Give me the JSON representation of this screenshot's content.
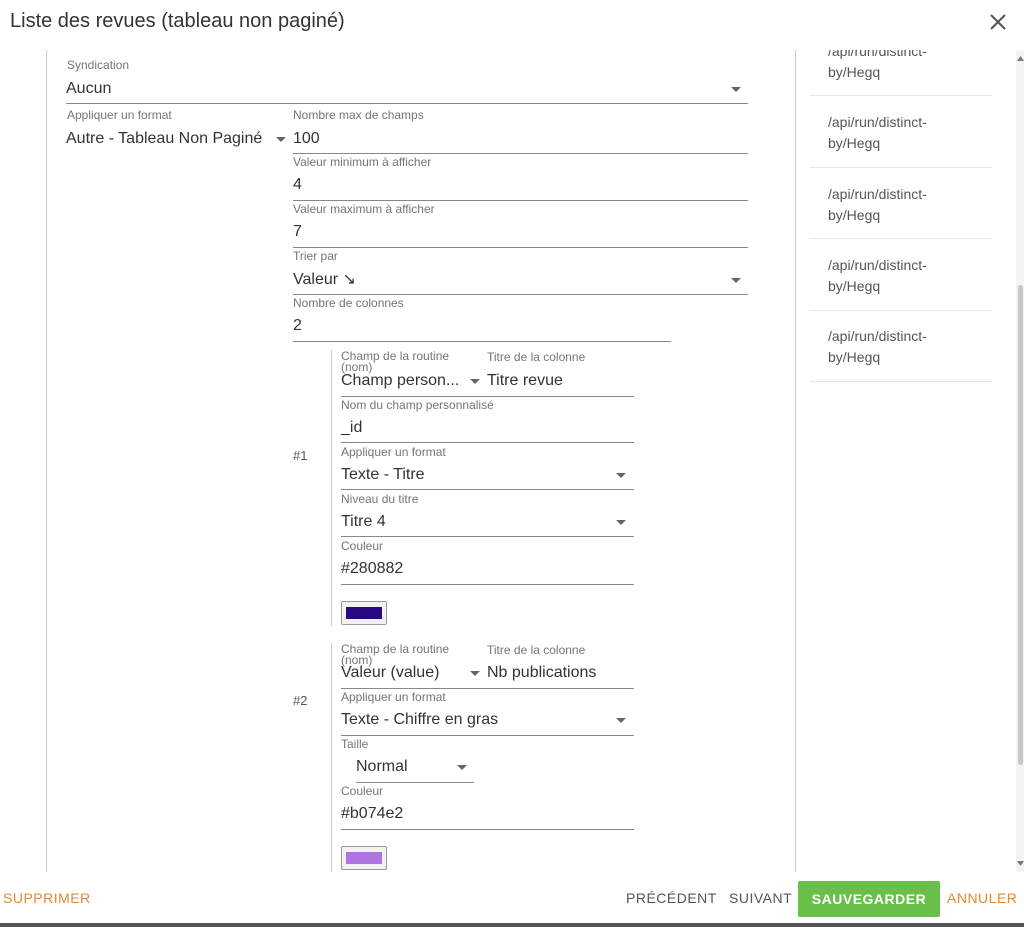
{
  "dialog": {
    "title": "Liste des revues (tableau non paginé)"
  },
  "form": {
    "syndication": {
      "label": "Syndication",
      "value": "Aucun"
    },
    "format": {
      "label": "Appliquer un format",
      "value": "Autre - Tableau Non Paginé"
    },
    "max_fields": {
      "label": "Nombre max de champs",
      "value": "100"
    },
    "min_value": {
      "label": "Valeur minimum à afficher",
      "value": "4"
    },
    "max_value": {
      "label": "Valeur maximum à afficher",
      "value": "7"
    },
    "sort_by": {
      "label": "Trier par",
      "value": "Valeur ↘"
    },
    "columns_count": {
      "label": "Nombre de colonnes",
      "value": "2"
    }
  },
  "columns": [
    {
      "number": "#1",
      "routine_field_label": "Champ de la routine (nom)",
      "routine_field_value": "Champ person...",
      "column_title_label": "Titre de la colonne",
      "column_title_value": "Titre revue",
      "custom_field_label": "Nom du champ personnalisé",
      "custom_field_value": "_id",
      "format_label": "Appliquer un format",
      "format_value": "Texte - Titre",
      "level_label": "Niveau du titre",
      "level_value": "Titre 4",
      "color_label": "Couleur",
      "color_value": "#280882",
      "swatch_color": "#280882"
    },
    {
      "number": "#2",
      "routine_field_label": "Champ de la routine (nom)",
      "routine_field_value": "Valeur (value)",
      "column_title_label": "Titre de la colonne",
      "column_title_value": "Nb publications",
      "format_label": "Appliquer un format",
      "format_value": "Texte - Chiffre en gras",
      "size_label": "Taille",
      "size_value": "Normal",
      "color_label": "Couleur",
      "color_value": "#b074e2",
      "swatch_color": "#b074e2"
    }
  ],
  "side_links": [
    "/api/run/distinct-by/Hegq",
    "/api/run/distinct-by/Hegq",
    "/api/run/distinct-by/Hegq",
    "/api/run/distinct-by/Hegq",
    "/api/run/distinct-by/Hegq"
  ],
  "side_link_lines": [
    "/api/run/distinct-",
    "by/Hegq"
  ],
  "footer": {
    "delete": "SUPPRIMER",
    "previous": "PRÉCÉDENT",
    "next": "SUIVANT",
    "save": "SAUVEGARDER",
    "cancel": "ANNULER"
  },
  "colors": {
    "accent": "#e8892b",
    "save": "#6abf4b"
  },
  "icons": [
    "close-icon",
    "dropdown-caret-icon",
    "scrollbar-up-icon",
    "scrollbar-down-icon"
  ]
}
